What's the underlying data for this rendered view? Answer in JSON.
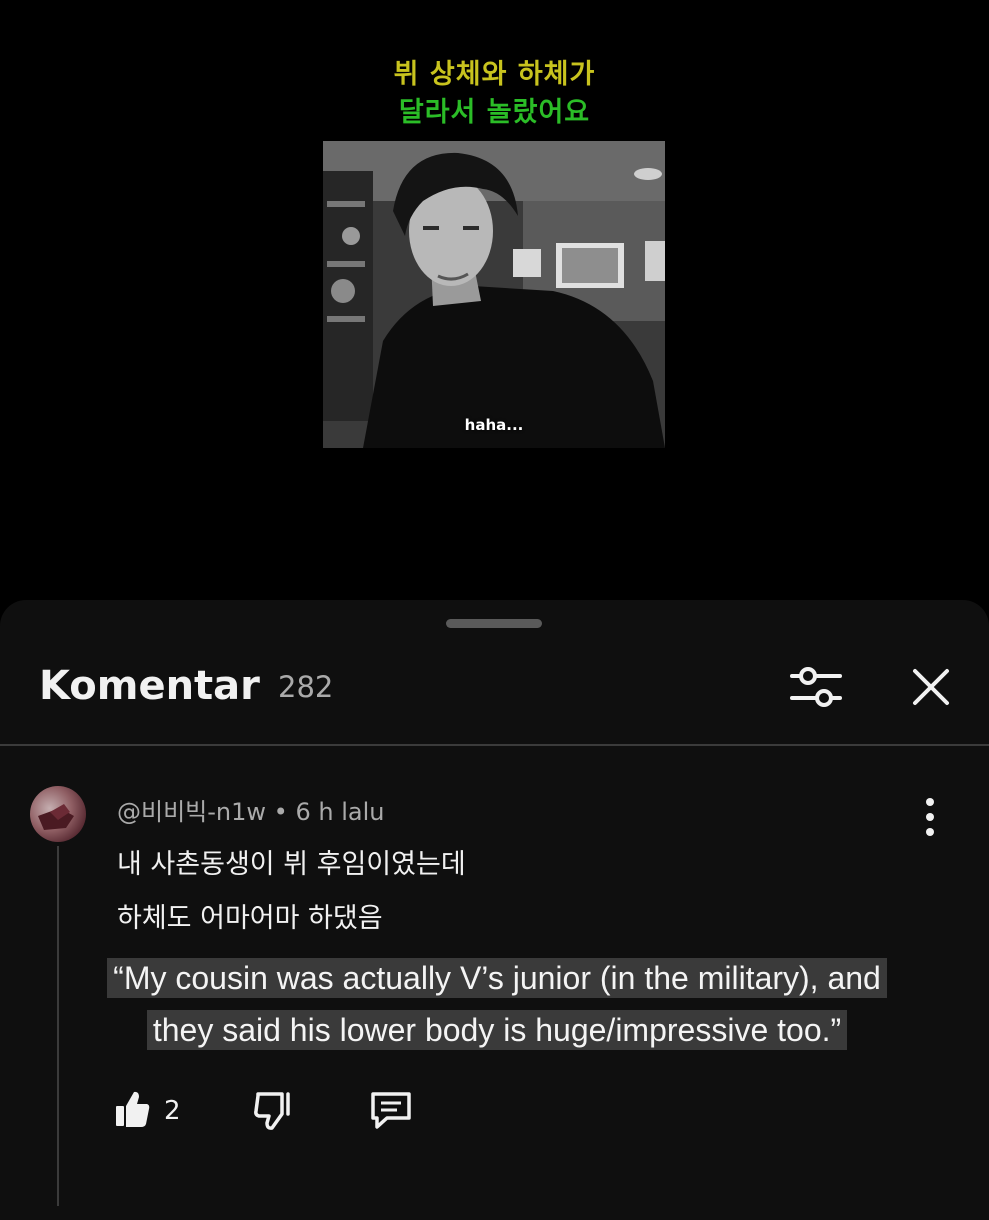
{
  "video": {
    "caption_line1": "뷔 상체와 하체가",
    "caption_line2": "달라서 놀랐어요",
    "subtitle": "haha...",
    "caption_colors": [
      "#c8c31e",
      "#2bbd27"
    ]
  },
  "comments_panel": {
    "title": "Komentar",
    "count": "282",
    "filter_icon": "sliders-icon",
    "close_icon": "close-icon"
  },
  "comment": {
    "author": "@비비빅-n1w",
    "separator": "•",
    "time": "6 h lalu",
    "text_line1": "내 사촌동생이 뷔 후임이였는데",
    "text_line2": "하체도 어마어마 하댔음",
    "translation_overlay": "“My cousin was actually V’s junior (in the military), and they said his lower body is huge/impressive too.”",
    "like_count": "2",
    "icons": [
      "like-icon",
      "dislike-icon",
      "reply-icon",
      "more-vert-icon"
    ]
  }
}
